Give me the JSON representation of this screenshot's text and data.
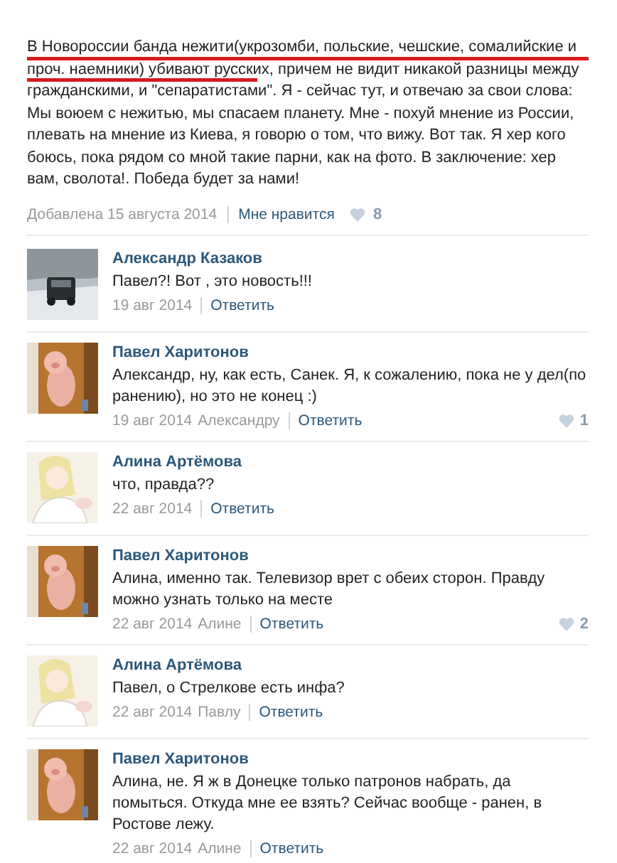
{
  "post": {
    "text": "В Новороссии банда нежити(укрозомби, польские, чешские, сомалийские и проч. наемники) убивают русских, причем не видит никакой разницы между гражданскими, и \"сепаратистами\". Я - сейчас тут, и отвечаю за свои слова: Мы воюем с нежитью, мы спасаем планету. Мне - похуй мнение из России, плевать на мнение из Киева, я говорю о том, что вижу. Вот так. Я хер кого боюсь, пока рядом со мной такие парни, как на фото. В заключение: хер вам, сволота!. Победа будет за нами!",
    "date": "Добавлена 15 августа 2014",
    "like_label": "Мне нравится",
    "likes": "8"
  },
  "comments": [
    {
      "author": "Александр Казаков",
      "text": "Павел?! Вот , это новость!!!",
      "date": "19 авг 2014",
      "reply_label": "Ответить"
    },
    {
      "author": "Павел Харитонов",
      "text": "Александр, ну, как есть, Санек. Я, к сожалению, пока не у дел(по ранению), но это не конец :)",
      "date": "19 авг 2014",
      "reply_to": "Александру",
      "reply_label": "Ответить",
      "likes": "1"
    },
    {
      "author": "Алина Артёмова",
      "text": "что, правда??",
      "date": "22 авг 2014",
      "reply_label": "Ответить"
    },
    {
      "author": "Павел Харитонов",
      "text": "Алина, именно так. Телевизор врет с обеих сторон. Правду можно узнать только на месте",
      "date": "22 авг 2014",
      "reply_to": "Алине",
      "reply_label": "Ответить",
      "likes": "2"
    },
    {
      "author": "Алина Артёмова",
      "text": "Павел, о Стрелкове есть инфа?",
      "date": "22 авг 2014",
      "reply_to": "Павлу",
      "reply_label": "Ответить"
    },
    {
      "author": "Павел Харитонов",
      "text": "Алина, не. Я ж в Донецке только патронов набрать, да помыться. Откуда мне ее взять? Сейчас вообще - ранен, в Ростове лежу.",
      "date": "22 авг 2014",
      "reply_to": "Алине",
      "reply_label": "Ответить"
    }
  ]
}
